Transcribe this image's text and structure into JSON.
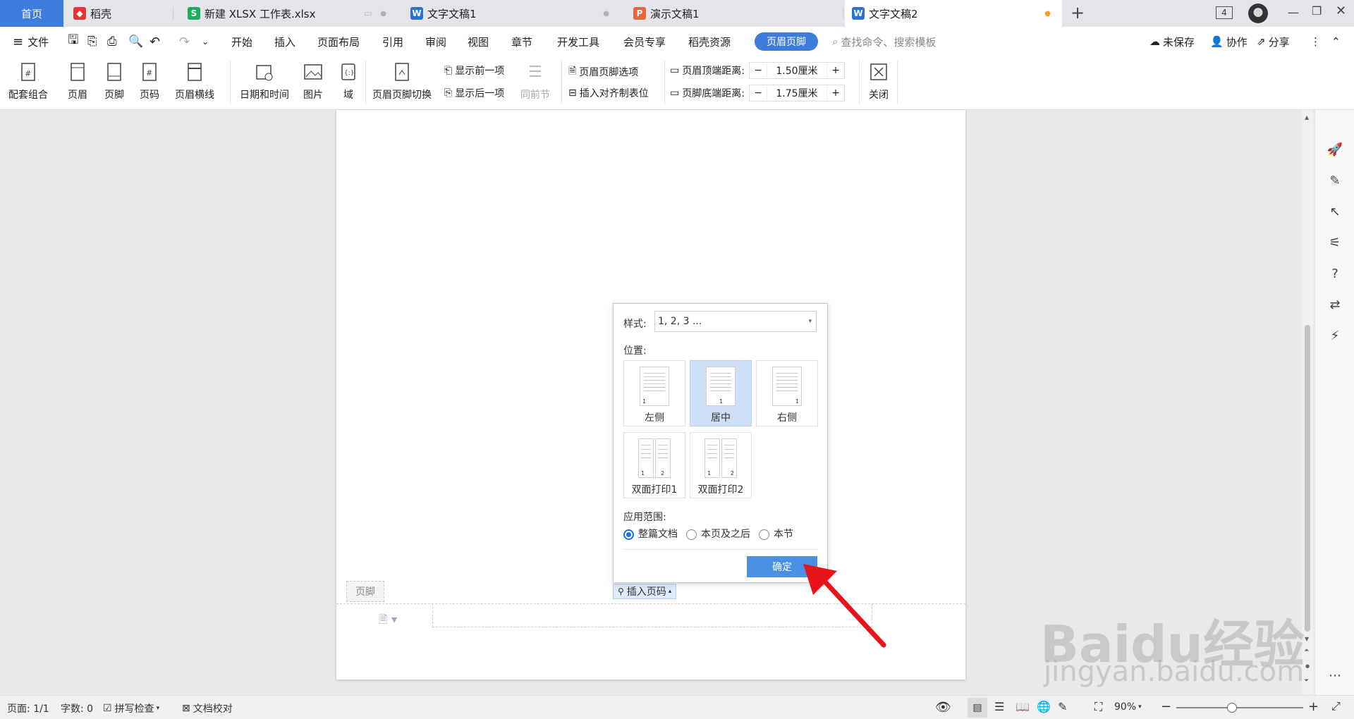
{
  "tabs": [
    {
      "label": "首页"
    },
    {
      "label": "稻壳"
    },
    {
      "label": "新建 XLSX 工作表.xlsx"
    },
    {
      "label": "文字文稿1"
    },
    {
      "label": "演示文稿1"
    },
    {
      "label": "文字文稿2"
    }
  ],
  "tab_add": "+",
  "window_count": "4",
  "menu": {
    "file": "文件",
    "items": [
      "开始",
      "插入",
      "页面布局",
      "引用",
      "审阅",
      "视图",
      "章节",
      "开发工具",
      "会员专享",
      "稻壳资源",
      "页眉页脚"
    ],
    "search_placeholder": "查找命令、搜索模板",
    "unsaved": "未保存",
    "collab": "协作",
    "share": "分享"
  },
  "ribbon": {
    "combo": "配套组合",
    "header": "页眉",
    "footer": "页脚",
    "pagenum": "页码",
    "header_line": "页眉横线",
    "datetime": "日期和时间",
    "picture": "图片",
    "field": "域",
    "switch": "页眉页脚切换",
    "show_prev": "显示前一项",
    "show_next": "显示后一项",
    "same_prev": "同前节",
    "hf_options": "页眉页脚选项",
    "insert_align": "插入对齐制表位",
    "top_dist_label": "页眉顶端距离:",
    "top_dist_value": "1.50厘米",
    "bottom_dist_label": "页脚底端距离:",
    "bottom_dist_value": "1.75厘米",
    "minus": "−",
    "plus": "+",
    "close": "关闭"
  },
  "dialog": {
    "style_label": "样式:",
    "style_value": "1, 2, 3 ...",
    "position_label": "位置:",
    "positions": [
      {
        "label": "左侧",
        "num": "1"
      },
      {
        "label": "居中",
        "num": "1"
      },
      {
        "label": "右侧",
        "num": "1"
      },
      {
        "label": "双面打印1",
        "num_l": "1",
        "num_r": "2"
      },
      {
        "label": "双面打印2",
        "num_l": "1",
        "num_r": "2"
      }
    ],
    "scope_label": "应用范围:",
    "scope_options": [
      "整篇文档",
      "本页及之后",
      "本节"
    ],
    "confirm": "确定"
  },
  "footer_tag": "页脚",
  "insert_pagenum": "插入页码",
  "status": {
    "page": "页面: 1/1",
    "words": "字数: 0",
    "spell": "拼写检查",
    "proof": "文档校对",
    "zoom": "90%"
  },
  "watermark": "Baidu经验",
  "watermark_url": "jingyan.baidu.com",
  "colors": {
    "accent": "#4a90e2",
    "active_tab": "#3d7bdc",
    "arrow": "#e8141b"
  }
}
